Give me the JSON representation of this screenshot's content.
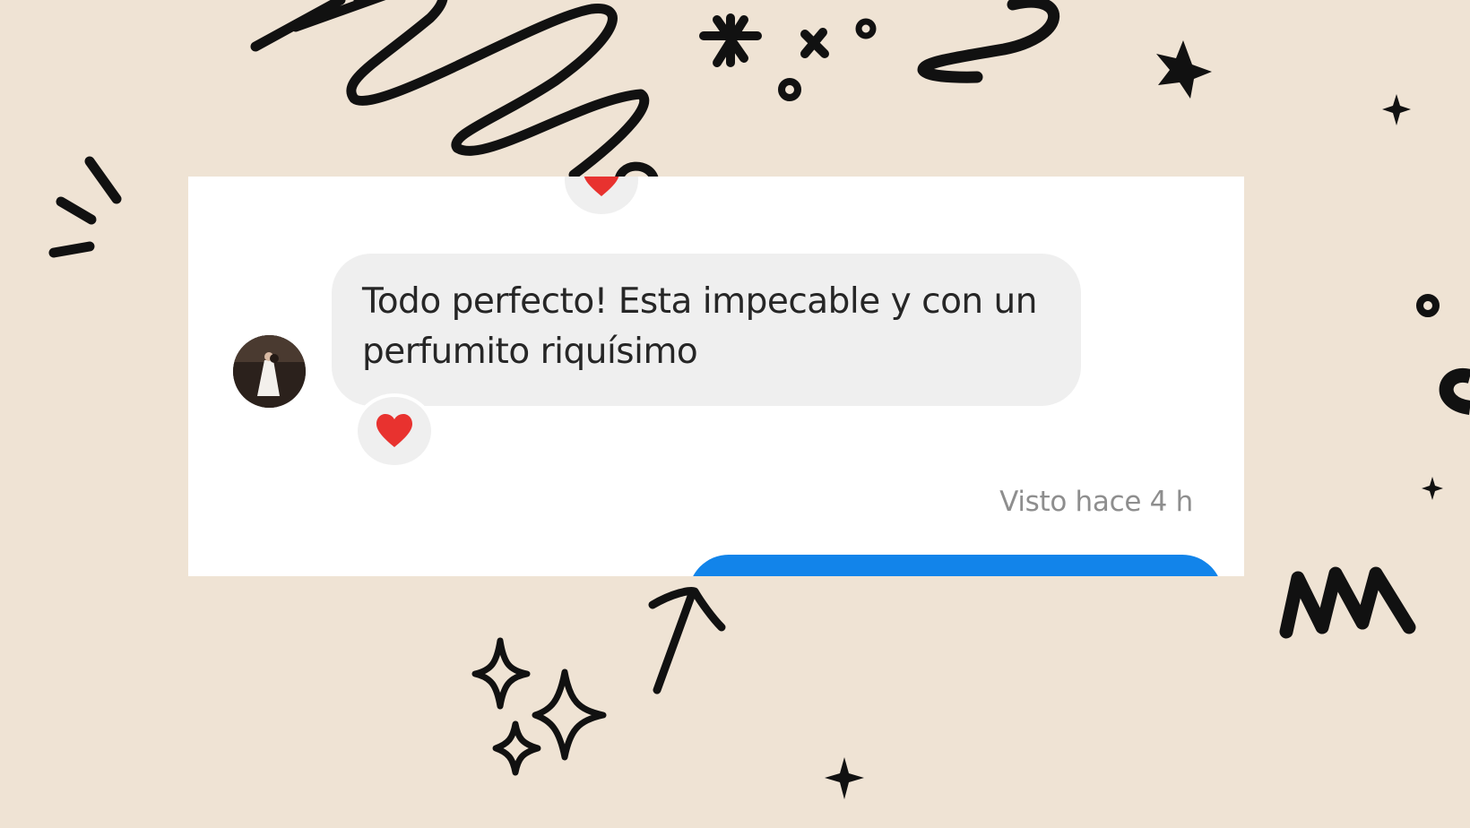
{
  "messages": [
    {
      "direction": "incoming",
      "text": "Todo perfecto! Esta impecable y con un perfumito riquísimo",
      "reaction": "heart"
    }
  ],
  "seen_status": "Visto hace 4 h",
  "colors": {
    "background": "#efe3d4",
    "card": "#ffffff",
    "incoming_bubble": "#efefef",
    "outgoing_bubble": "#1284ea",
    "heart": "#e8322f",
    "doodle": "#111111"
  },
  "icons": [
    "heart-reaction-icon",
    "avatar-photo"
  ]
}
